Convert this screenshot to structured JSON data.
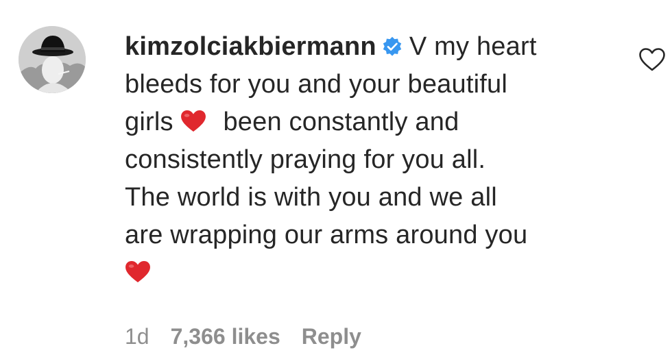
{
  "comment": {
    "username": "kimzolciakbiermann",
    "verified": true,
    "line1": "V my heart",
    "line2": "bleeds for you and your beautiful",
    "line3a": "girls",
    "line3b": "been constantly and",
    "line4": "consistently praying for you all.",
    "line5": "The world is with you and we all",
    "line6": "are wrapping our arms around you",
    "emoji": [
      "red-heart",
      "red-heart"
    ]
  },
  "meta": {
    "timestamp": "1d",
    "likes": "7,366 likes",
    "reply_label": "Reply"
  },
  "icons": {
    "verified": "verified-badge-icon",
    "like": "heart-outline-icon"
  },
  "colors": {
    "text": "#262626",
    "meta": "#8e8e8e",
    "verified": "#3897f0",
    "heart_emoji": "#e0282e"
  }
}
